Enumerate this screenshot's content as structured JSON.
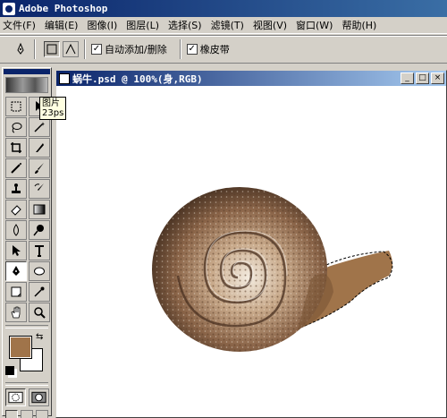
{
  "app": {
    "title": "Adobe Photoshop"
  },
  "menu": [
    "文件(F)",
    "编辑(E)",
    "图像(I)",
    "图层(L)",
    "选择(S)",
    "滤镜(T)",
    "视图(V)",
    "窗口(W)",
    "帮助(H)"
  ],
  "options": {
    "auto_add_delete": "自动添加/删除",
    "rubber_band": "橡皮带",
    "auto_add_checked": true,
    "rubber_band_checked": true
  },
  "tooltip": {
    "line1": "图片",
    "line2": "23ps"
  },
  "document": {
    "title": "蜗牛.psd @ 100%(身,RGB)"
  },
  "colors": {
    "foreground": "#a0744a",
    "background": "#ffffff"
  },
  "icons": [
    "marquee-icon",
    "move-icon",
    "lasso-icon",
    "magic-wand-icon",
    "crop-icon",
    "slice-icon",
    "airbrush-icon",
    "paintbrush-icon",
    "clone-stamp-icon",
    "history-brush-icon",
    "eraser-icon",
    "gradient-icon",
    "blur-icon",
    "dodge-icon",
    "path-select-icon",
    "type-icon",
    "pen-icon",
    "ellipse-icon",
    "notes-icon",
    "eyedropper-icon",
    "hand-icon",
    "zoom-icon"
  ]
}
